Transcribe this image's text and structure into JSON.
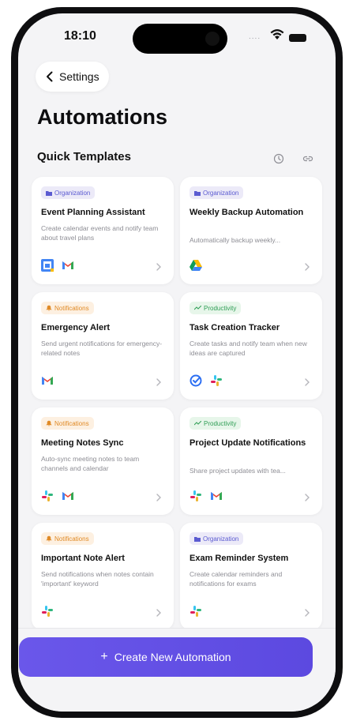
{
  "status": {
    "time": "18:10",
    "signal": "...."
  },
  "nav": {
    "back_label": "Settings"
  },
  "page": {
    "title": "Automations"
  },
  "section": {
    "title": "Quick Templates"
  },
  "cards": [
    {
      "category": "Organization",
      "title": "Event Planning Assistant",
      "desc": "Create calendar events and notify team about travel plans"
    },
    {
      "category": "Organization",
      "title": "Weekly Backup Automation",
      "desc": "Automatically backup weekly..."
    },
    {
      "category": "Notifications",
      "title": "Emergency Alert",
      "desc": "Send urgent notifications for emergency-related notes"
    },
    {
      "category": "Productivity",
      "title": "Task Creation Tracker",
      "desc": "Create tasks and notify team when new ideas are captured"
    },
    {
      "category": "Notifications",
      "title": "Meeting Notes Sync",
      "desc": "Auto-sync meeting notes to team channels and calendar"
    },
    {
      "category": "Productivity",
      "title": "Project Update Notifications",
      "desc": "Share project updates with tea..."
    },
    {
      "category": "Notifications",
      "title": "Important Note Alert",
      "desc": "Send notifications when notes contain 'important' keyword"
    },
    {
      "category": "Organization",
      "title": "Exam Reminder System",
      "desc": "Create calendar reminders and notifications for exams"
    }
  ],
  "footer": {
    "create_label": "Create New Automation",
    "create_icon": "+"
  },
  "icons": {
    "card_0": [
      "google-calendar-icon",
      "gmail-icon"
    ],
    "card_1": [
      "google-drive-icon"
    ],
    "card_2": [
      "gmail-icon"
    ],
    "card_3": [
      "tasks-check-icon",
      "slack-icon"
    ],
    "card_4": [
      "slack-icon",
      "gmail-icon"
    ],
    "card_5": [
      "slack-icon",
      "gmail-icon"
    ],
    "card_6": [
      "slack-icon"
    ],
    "card_7": [
      "slack-icon"
    ]
  },
  "colors": {
    "accent": "#5c49e0",
    "organization": "#5b5bd1",
    "notifications": "#e08a26",
    "productivity": "#2f9e55"
  }
}
